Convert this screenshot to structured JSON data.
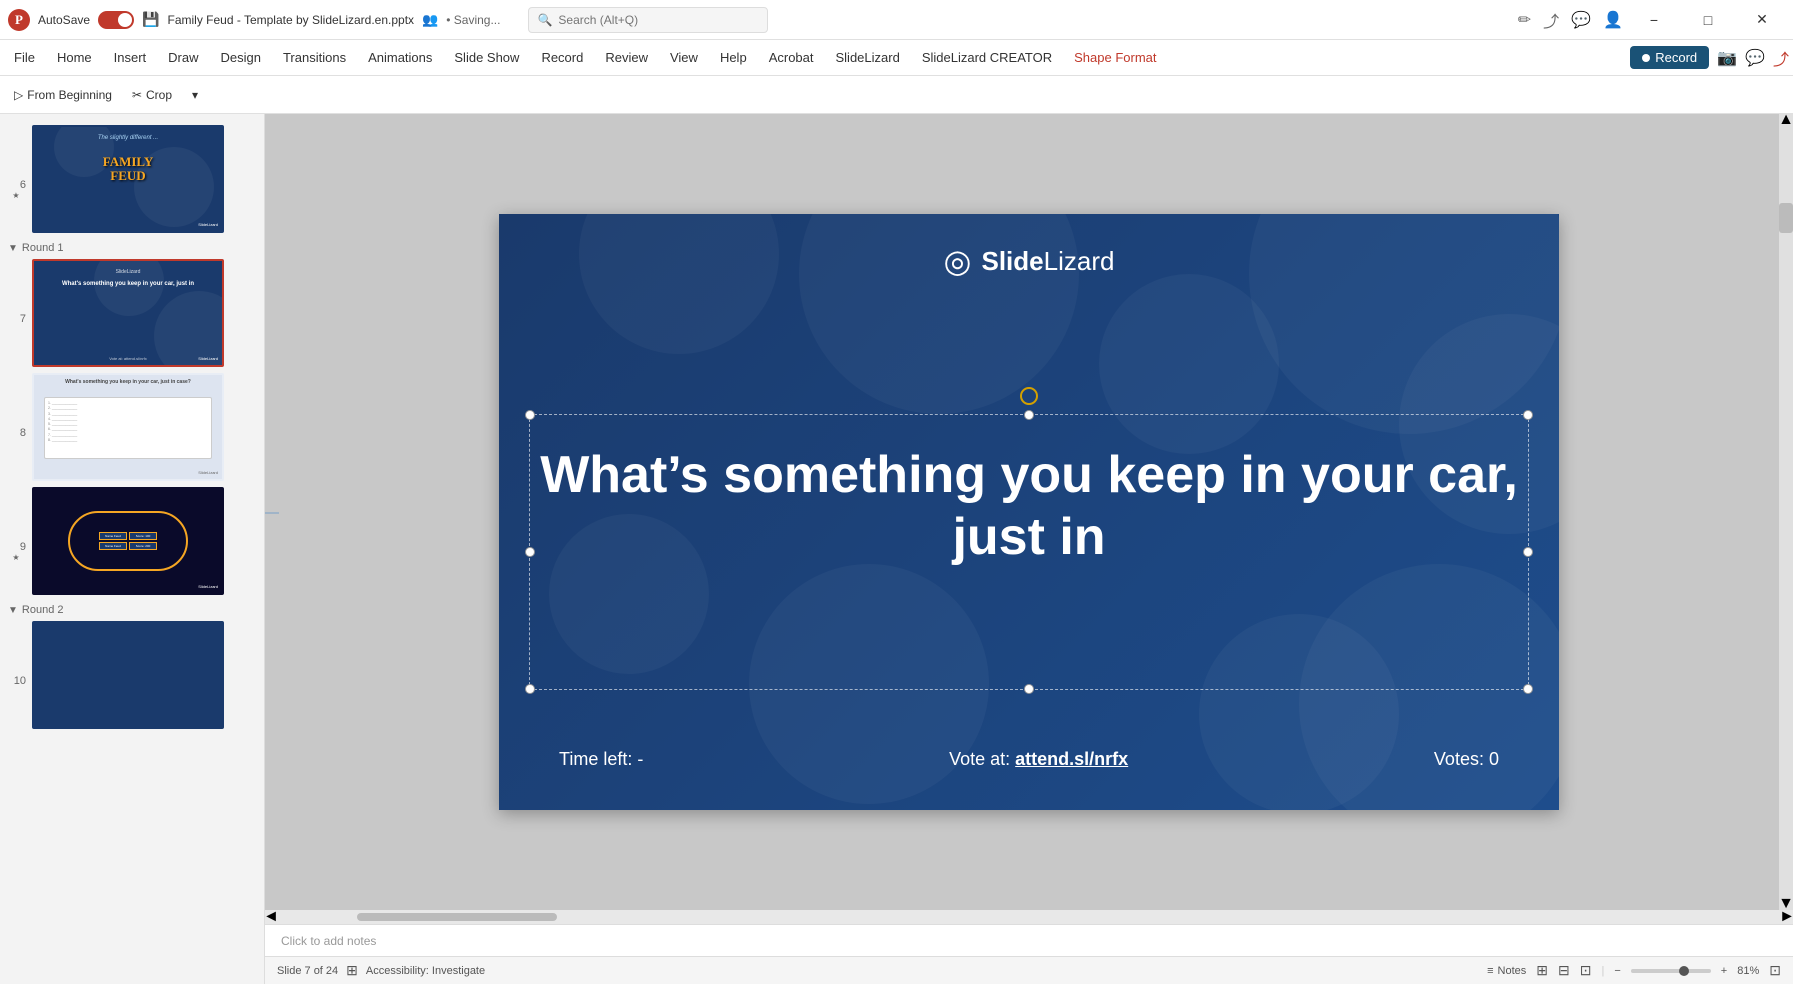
{
  "titlebar": {
    "app_icon": "P",
    "autosave_label": "AutoSave",
    "filename": "Family Feud - Template by SlideLizard.en.pptx",
    "saving_label": "• Saving...",
    "search_placeholder": "Search (Alt+Q)",
    "minimize_label": "−",
    "maximize_label": "□",
    "close_label": "✕",
    "edit_icon": "✏",
    "user_icon": "👤"
  },
  "menubar": {
    "items": [
      {
        "id": "file",
        "label": "File"
      },
      {
        "id": "home",
        "label": "Home"
      },
      {
        "id": "insert",
        "label": "Insert"
      },
      {
        "id": "draw",
        "label": "Draw"
      },
      {
        "id": "design",
        "label": "Design"
      },
      {
        "id": "transitions",
        "label": "Transitions"
      },
      {
        "id": "animations",
        "label": "Animations"
      },
      {
        "id": "slideshow",
        "label": "Slide Show"
      },
      {
        "id": "record",
        "label": "Record"
      },
      {
        "id": "review",
        "label": "Review"
      },
      {
        "id": "view",
        "label": "View"
      },
      {
        "id": "help",
        "label": "Help"
      },
      {
        "id": "acrobat",
        "label": "Acrobat"
      },
      {
        "id": "slidelizard",
        "label": "SlideLizard"
      },
      {
        "id": "slidelizard_creator",
        "label": "SlideLizard CREATOR"
      },
      {
        "id": "shape_format",
        "label": "Shape Format",
        "active": true
      }
    ],
    "record_button": "⏺ Record",
    "record_label": "Record"
  },
  "toolbar": {
    "from_beginning_label": "From Beginning",
    "crop_label": "Crop",
    "dropdown_arrow": "▾"
  },
  "slide_panel": {
    "sections": [
      {
        "id": "round1",
        "label": "Round 1",
        "collapsed": false,
        "slides": [
          {
            "number": "7",
            "active": true,
            "text": "What's something you keep in your car, just in",
            "subtext": "Vote at: attend.sl/nrfx"
          },
          {
            "number": "8",
            "active": false,
            "text": "What's something you keep in your car, just in case?",
            "subtext": ""
          },
          {
            "number": "9",
            "star": true,
            "active": false,
            "text": "Game board slide",
            "subtext": ""
          }
        ]
      },
      {
        "id": "round2",
        "label": "Round 2",
        "collapsed": false,
        "slides": [
          {
            "number": "10",
            "active": false,
            "text": "",
            "subtext": ""
          }
        ]
      }
    ],
    "prev_slides": [
      {
        "number": "6",
        "star": true,
        "text": "The slightly different ... Family Feud",
        "subtext": ""
      }
    ]
  },
  "slide": {
    "logo_text": "SlideLizard",
    "logo_bold": "Slide",
    "main_text": "What’s something you keep in your car, just in",
    "footer_left": "Time left:",
    "footer_left_value": "-",
    "footer_center_prefix": "Vote at:",
    "footer_center_url": "attend.sl/nrfx",
    "footer_right_prefix": "Votes:",
    "footer_right_value": "0"
  },
  "statusbar": {
    "slide_info": "Slide 7 of 24",
    "accessibility": "Accessibility: Investigate",
    "notes_label": "Notes",
    "zoom_level": "81%",
    "notes_icon": "≡",
    "slide_icon": "⊞",
    "grid_icon": "⊟",
    "fit_icon": "⊡",
    "zoom_minus": "−",
    "zoom_plus": "+"
  },
  "notes_area": {
    "placeholder": "Click to add notes"
  }
}
